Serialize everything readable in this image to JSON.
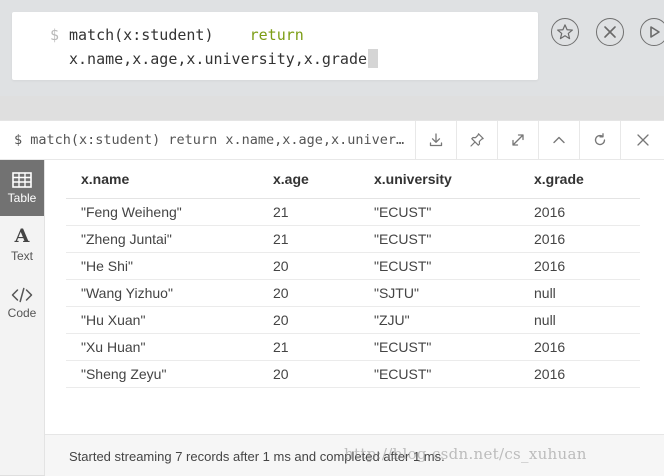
{
  "editor": {
    "prompt": "$",
    "line1_code": "match(x:student)",
    "line1_keyword": "return",
    "line2_code": "x.name,x.age,x.university,x.grade"
  },
  "frame": {
    "title": "$ match(x:student) return x.name,x.age,x.university,x.grade"
  },
  "views": [
    {
      "label": "Table",
      "icon": "table-icon",
      "active": true
    },
    {
      "label": "Text",
      "icon": "text-icon",
      "active": false
    },
    {
      "label": "Code",
      "icon": "code-icon",
      "active": false
    }
  ],
  "table": {
    "columns": [
      "x.name",
      "x.age",
      "x.university",
      "x.grade"
    ],
    "rows": [
      [
        "\"Feng Weiheng\"",
        "21",
        "\"ECUST\"",
        "2016"
      ],
      [
        "\"Zheng Juntai\"",
        "21",
        "\"ECUST\"",
        "2016"
      ],
      [
        "\"He Shi\"",
        "20",
        "\"ECUST\"",
        "2016"
      ],
      [
        "\"Wang Yizhuo\"",
        "20",
        "\"SJTU\"",
        "null"
      ],
      [
        "\"Hu Xuan\"",
        "20",
        "\"ZJU\"",
        "null"
      ],
      [
        "\"Xu Huan\"",
        "21",
        "\"ECUST\"",
        "2016"
      ],
      [
        "\"Sheng Zeyu\"",
        "20",
        "\"ECUST\"",
        "2016"
      ]
    ]
  },
  "status": "Started streaming 7 records after 1 ms and completed after 1 ms.",
  "watermark": "http://blog.csdn.net/cs_xuhuan",
  "colors": {
    "keyword": "#7c9d15",
    "active_tab": "#727272",
    "background": "#dfdfdf"
  }
}
